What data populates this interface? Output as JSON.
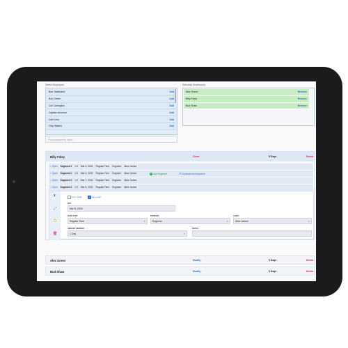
{
  "select_panel": {
    "label": "Select Employee",
    "items": [
      {
        "name": "Bea Tasterland",
        "action": "Add"
      },
      {
        "name": "Bob Green",
        "action": "Add"
      },
      {
        "name": "Cal Carrington",
        "action": "Add"
      },
      {
        "name": "Captain America",
        "action": "Add"
      },
      {
        "name": "Carl Lens",
        "action": "Add"
      },
      {
        "name": "Chip Waters",
        "action": "Add"
      }
    ],
    "search_placeholder": "Find employee by name..."
  },
  "selected_panel": {
    "label": "Selected Employees",
    "items": [
      {
        "name": "Alex Green",
        "action": "Remove"
      },
      {
        "name": "Billy Foley",
        "action": "Remove"
      },
      {
        "name": "Bud Shaw",
        "action": "Remove"
      }
    ]
  },
  "active_card": {
    "name": "Billy Foley",
    "close_label": "Close",
    "days": "5 Days",
    "delete_label": "Delete",
    "segments": [
      {
        "open": "↕ Open",
        "name": "Segment 1",
        "hours": "1.0",
        "date": "Mar 4, 2024",
        "time_type": "Regular Time",
        "position": "Engineer",
        "asset": "Alice James"
      },
      {
        "open": "↕ Open",
        "name": "Segment 2",
        "hours": "1.0",
        "date": "Mar 6, 2024",
        "time_type": "Regular Time",
        "position": "Engineer",
        "asset": "Alice James"
      },
      {
        "open": "↕ Open",
        "name": "Segment 3",
        "hours": "1.0",
        "date": "Mar 7, 2024",
        "time_type": "Regular Time",
        "position": "Engineer",
        "asset": "Alice James"
      },
      {
        "open": "↕ Open",
        "name": "Segment 4",
        "hours": "1.0",
        "date": "Mar 8, 2024",
        "time_type": "Regular Time",
        "position": "Engineer",
        "asset": "Alice James"
      }
    ],
    "detail": {
      "number": "1",
      "hour_mode_label": "Hour mode",
      "day_mode_label": "Day mode",
      "day_label": "DAY",
      "day_value": "Mar 8, 2024",
      "date_type_label": "DATE TYPE",
      "date_type_value": "Regular Time",
      "position_label": "POSITION",
      "position_value": "Engineer",
      "asset_label": "ASSET",
      "asset_value": "Alice James",
      "amount_worked_label": "AMOUNT WORKED",
      "amount_worked_value": "1 Day",
      "notes_label": "NOTES",
      "notes_value": ""
    },
    "add_segment_label": "Add Segment",
    "duplicate_label": "Duplicate last segment"
  },
  "other_employees": [
    {
      "name": "Alex Green",
      "modify": "Modify",
      "days": "5 Days",
      "delete": "Delete"
    },
    {
      "name": "Bud Shaw",
      "modify": "Modify",
      "days": "5 Days",
      "delete": "Delete"
    }
  ],
  "colors": {
    "accent_blue": "#2a6fd1",
    "danger_red": "#d21f47",
    "success_green": "#2fa344",
    "selected_green": "#c8ecc4"
  },
  "icons": {
    "expand": "expand-icon",
    "copy": "copy-icon",
    "trash": "trash-icon"
  }
}
